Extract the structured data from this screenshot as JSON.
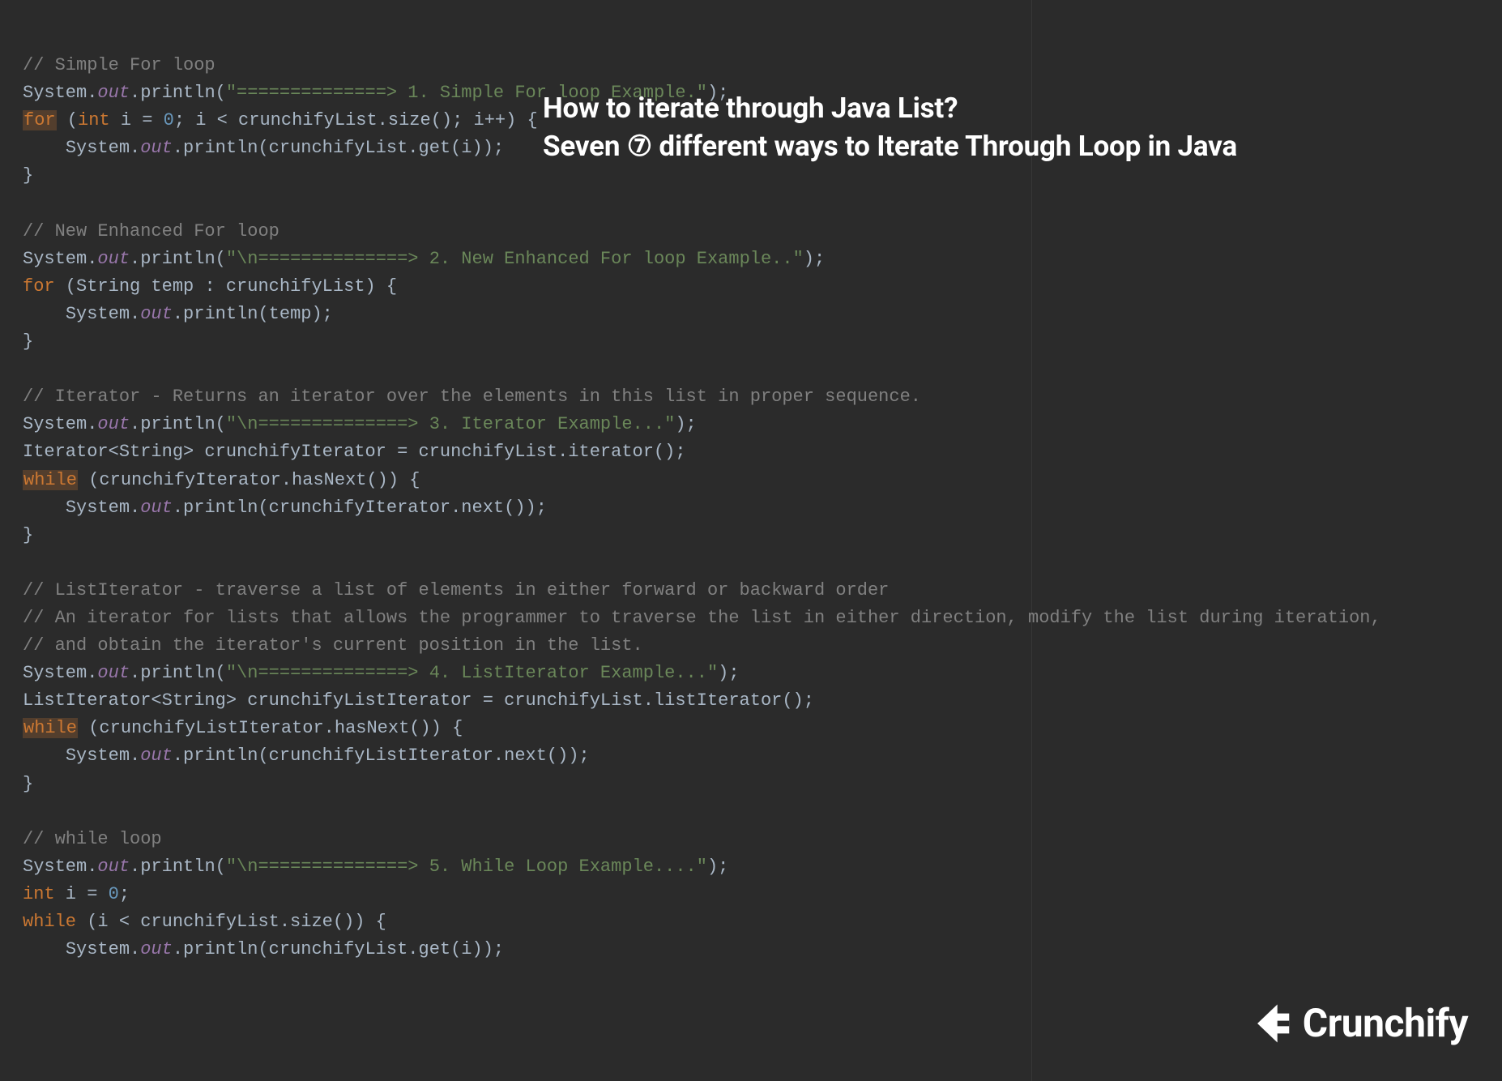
{
  "title": {
    "line1": "How to iterate through Java List?",
    "line2_prefix": "Seven ",
    "line2_circled": "⑦",
    "line2_suffix": " different ways to Iterate Through Loop in Java"
  },
  "brand": "Crunchify",
  "code": {
    "c1": "// Simple For loop",
    "sys": "System.",
    "out": "out",
    "println": ".println(",
    "str1": "\"==============> 1. Simple For loop Example.\"",
    "semi": ");",
    "for": "for",
    "int": "int",
    "i_eq": " i = ",
    "zero": "0",
    "for_cond": "; i < crunchifyList.size(); i++) {",
    "get_i": "System.",
    "get_i_tail": ".println(crunchifyList.get(i));",
    "brace_close": "}",
    "c2": "// New Enhanced For loop",
    "str2": "\"\\n==============> 2. New Enhanced For loop Example..\"",
    "for2_head": " (String temp : crunchifyList) {",
    "print_temp": ".println(temp);",
    "c3": "// Iterator - Returns an iterator over the elements in this list in proper sequence.",
    "str3": "\"\\n==============> 3. Iterator Example...\"",
    "iter_decl": "Iterator<String> crunchifyIterator = crunchifyList.iterator();",
    "while": "while",
    "iter_cond": " (crunchifyIterator.hasNext()) {",
    "iter_body": ".println(crunchifyIterator.next());",
    "c4a": "// ListIterator - traverse a list of elements in either forward or backward order",
    "c4b": "// An iterator for lists that allows the programmer to traverse the list in either direction, modify the list during iteration,",
    "c4c": "// and obtain the iterator's current position in the list.",
    "str4": "\"\\n==============> 4. ListIterator Example...\"",
    "li_decl": "ListIterator<String> crunchifyListIterator = crunchifyList.listIterator();",
    "li_cond": " (crunchifyListIterator.hasNext()) {",
    "li_body": ".println(crunchifyListIterator.next());",
    "c5": "// while loop",
    "str5": "\"\\n==============> 5. While Loop Example....\"",
    "int_i0": " i = ",
    "while5_cond": " (i < crunchifyList.size()) {",
    "while5_body": ".println(crunchifyList.get(i));"
  }
}
